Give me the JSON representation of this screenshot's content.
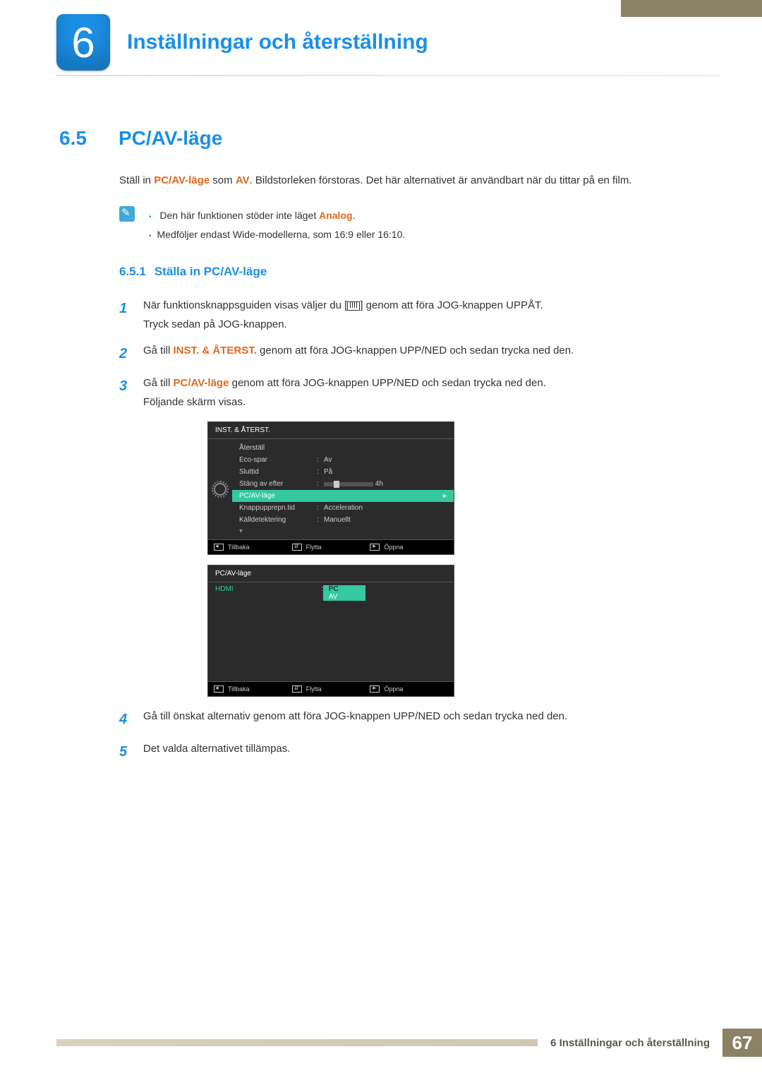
{
  "chapter": {
    "number": "6",
    "title": "Inställningar och återställning"
  },
  "section": {
    "number": "6.5",
    "title": "PC/AV-läge"
  },
  "intro": {
    "pre": "Ställ in ",
    "bold1": "PC/AV-läge",
    "mid": " som ",
    "bold2": "AV",
    "post": ". Bildstorleken förstoras. Det här alternativet är användbart när du tittar på en film."
  },
  "notes": {
    "line1_pre": "Den här funktionen stöder inte läget ",
    "line1_bold": "Analog",
    "line1_post": ".",
    "line2": "Medföljer endast Wide-modellerna, som 16:9 eller 16:10."
  },
  "subsection": {
    "number": "6.5.1",
    "title": "Ställa in PC/AV-läge"
  },
  "steps": {
    "s1": {
      "num": "1",
      "a": "När funktionsknappsguiden visas väljer du [",
      "b": "] genom att föra JOG-knappen UPPÅT.",
      "c": "Tryck sedan på JOG-knappen."
    },
    "s2": {
      "num": "2",
      "a": "Gå till ",
      "bold": "INST. & ÅTERST.",
      "b": " genom att föra JOG-knappen UPP/NED och sedan trycka ned den."
    },
    "s3": {
      "num": "3",
      "a": "Gå till ",
      "bold": "PC/AV-läge",
      "b": " genom att föra JOG-knappen UPP/NED och sedan trycka ned den.",
      "c": "Följande skärm visas."
    },
    "s4": {
      "num": "4",
      "text": "Gå till önskat alternativ genom att föra JOG-knappen UPP/NED och sedan trycka ned den."
    },
    "s5": {
      "num": "5",
      "text": "Det valda alternativet tillämpas."
    }
  },
  "osd1": {
    "title": "INST. & ÅTERST.",
    "rows": {
      "r1": {
        "label": "Återställ",
        "value": ""
      },
      "r2": {
        "label": "Eco-spar",
        "value": "Av"
      },
      "r3": {
        "label": "Sluttid",
        "value": "På"
      },
      "r4": {
        "label": "Stäng av efter",
        "value": "4h"
      },
      "r5": {
        "label": "PC/AV-läge",
        "value": ""
      },
      "r6": {
        "label": "Knappupprepn.tid",
        "value": "Acceleration"
      },
      "r7": {
        "label": "Källdetektering",
        "value": "Manuellt"
      }
    },
    "footer": {
      "back": "Tillbaka",
      "move": "Flytta",
      "open": "Öppna"
    }
  },
  "osd2": {
    "title": "PC/AV-läge",
    "row": {
      "label": "HDMI",
      "opt1": "PC",
      "opt2": "AV"
    },
    "footer": {
      "back": "Tillbaka",
      "move": "Flytta",
      "open": "Öppna"
    }
  },
  "footer": {
    "text": "6 Inställningar och återställning",
    "page": "67"
  }
}
